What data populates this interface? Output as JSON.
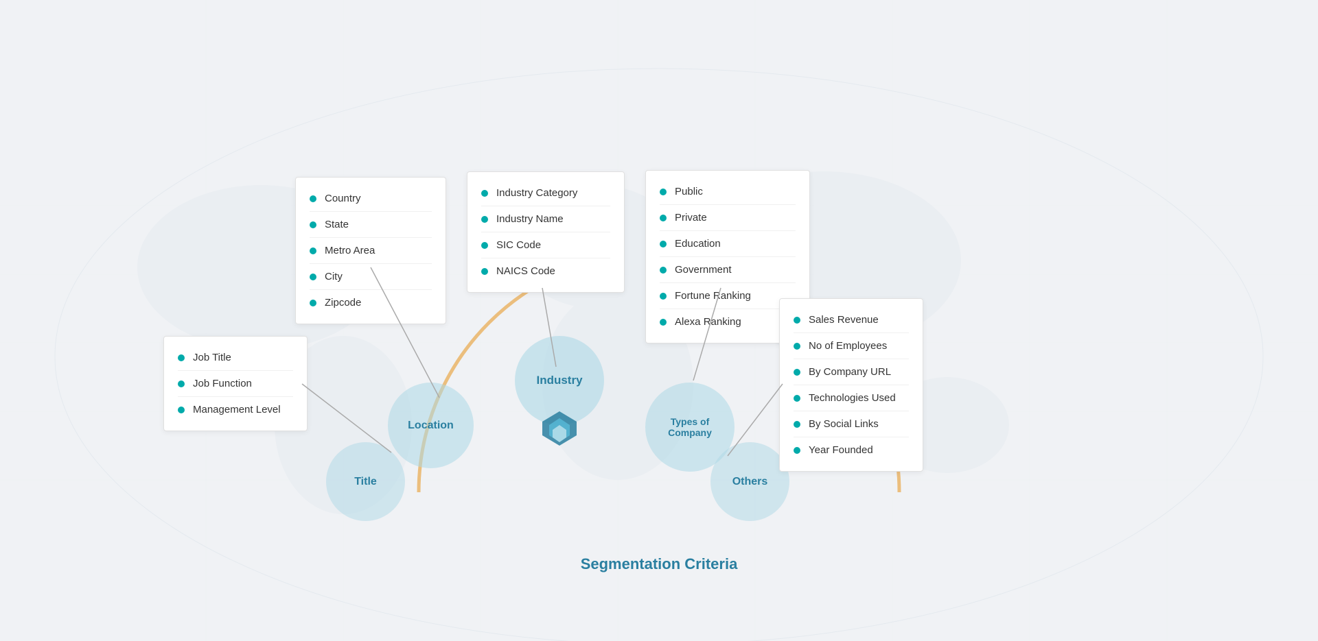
{
  "title": "Segmentation Criteria",
  "cards": {
    "location": {
      "label": "Location",
      "items": [
        "Country",
        "State",
        "Metro Area",
        "City",
        "Zipcode"
      ]
    },
    "industry": {
      "label": "Industry",
      "items": [
        "Industry Category",
        "Industry Name",
        "SIC Code",
        "NAICS Code"
      ]
    },
    "types": {
      "label": "Types of Company",
      "items": [
        "Public",
        "Private",
        "Education",
        "Government",
        "Fortune Ranking",
        "Alexa Ranking"
      ]
    },
    "title": {
      "label": "Title",
      "items": [
        "Job Title",
        "Job Function",
        "Management Level"
      ]
    },
    "others": {
      "label": "Others",
      "items": [
        "Sales Revenue",
        "No of Employees",
        "By Company URL",
        "Technologies Used",
        "By Social Links",
        "Year Founded"
      ]
    }
  },
  "accent_color": "#00aaaa",
  "brand_color": "#2a7fa0",
  "logo_color1": "#2a7fa0",
  "logo_color2": "#5bc0de"
}
